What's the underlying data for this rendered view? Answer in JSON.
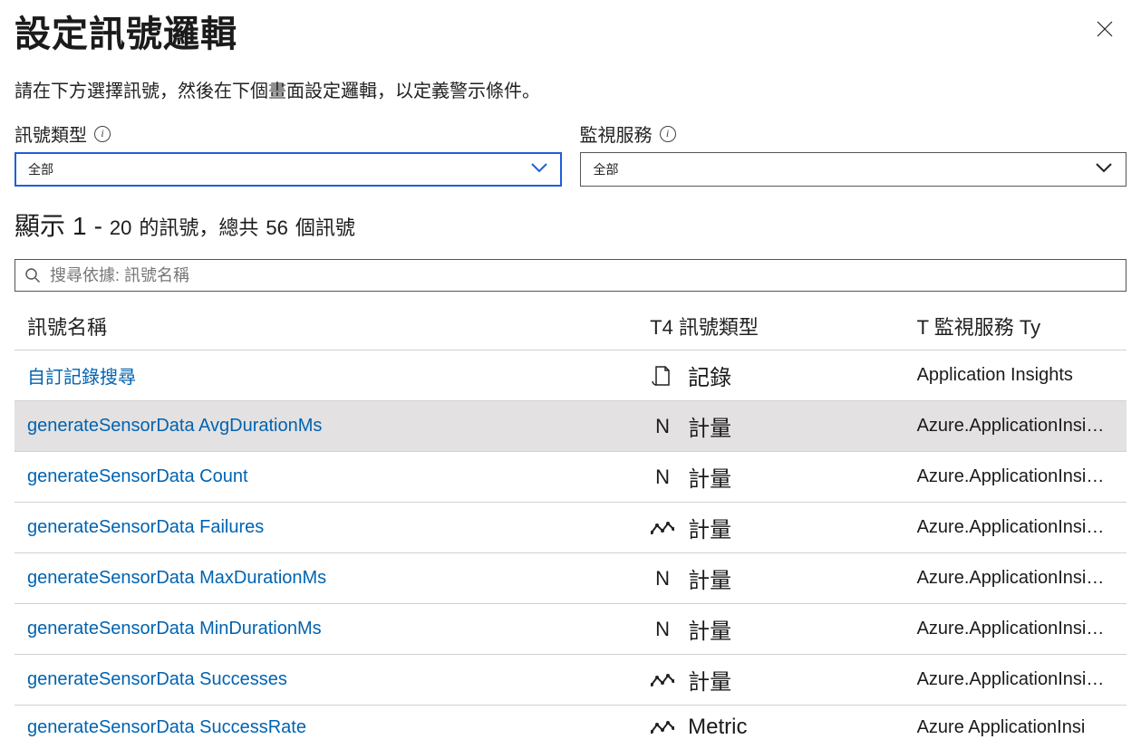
{
  "header": {
    "title": "設定訊號邏輯",
    "subtitle": "請在下方選擇訊號，然後在下個畫面設定邏輯，以定義警示條件。"
  },
  "filters": {
    "signalType": {
      "label": "訊號類型",
      "value": "全部"
    },
    "monitorService": {
      "label": "監視服務",
      "value": "全部"
    }
  },
  "count": {
    "prefix": "顯示",
    "from": "1",
    "dash": "-",
    "to": "20",
    "mid": "的訊號，總共",
    "total": "56",
    "suffix": "個訊號"
  },
  "search": {
    "placeholder": "搜尋依據: 訊號名稱"
  },
  "table": {
    "headers": {
      "name": "訊號名稱",
      "type": "T4 訊號類型",
      "service": "T 監視服務 Ty"
    },
    "rows": [
      {
        "name": "自訂記錄搜尋",
        "typeLabel": "記錄",
        "typeGlyph": "log",
        "service": "Application Insights",
        "highlight": false
      },
      {
        "name": "generateSensorData AvgDurationMs",
        "typeLabel": "計量",
        "typeGlyph": "N",
        "service": "Azure.ApplicationInsi…",
        "highlight": true
      },
      {
        "name": "generateSensorData Count",
        "typeLabel": "計量",
        "typeGlyph": "N",
        "service": "Azure.ApplicationInsi…",
        "highlight": false
      },
      {
        "name": "generateSensorData Failures",
        "typeLabel": "計量",
        "typeGlyph": "chart",
        "service": "Azure.ApplicationInsi…",
        "highlight": false
      },
      {
        "name": "generateSensorData MaxDurationMs",
        "typeLabel": "計量",
        "typeGlyph": "N",
        "service": "Azure.ApplicationInsi…",
        "highlight": false
      },
      {
        "name": "generateSensorData MinDurationMs",
        "typeLabel": "計量",
        "typeGlyph": "N",
        "service": "Azure.ApplicationInsi…",
        "highlight": false
      },
      {
        "name": "generateSensorData Successes",
        "typeLabel": "計量",
        "typeGlyph": "chart",
        "service": "Azure.ApplicationInsi…",
        "highlight": false
      },
      {
        "name": "generateSensorData SuccessRate",
        "typeLabel": "Metric",
        "typeGlyph": "chart",
        "service": "Azure ApplicationInsi",
        "highlight": false
      }
    ]
  }
}
